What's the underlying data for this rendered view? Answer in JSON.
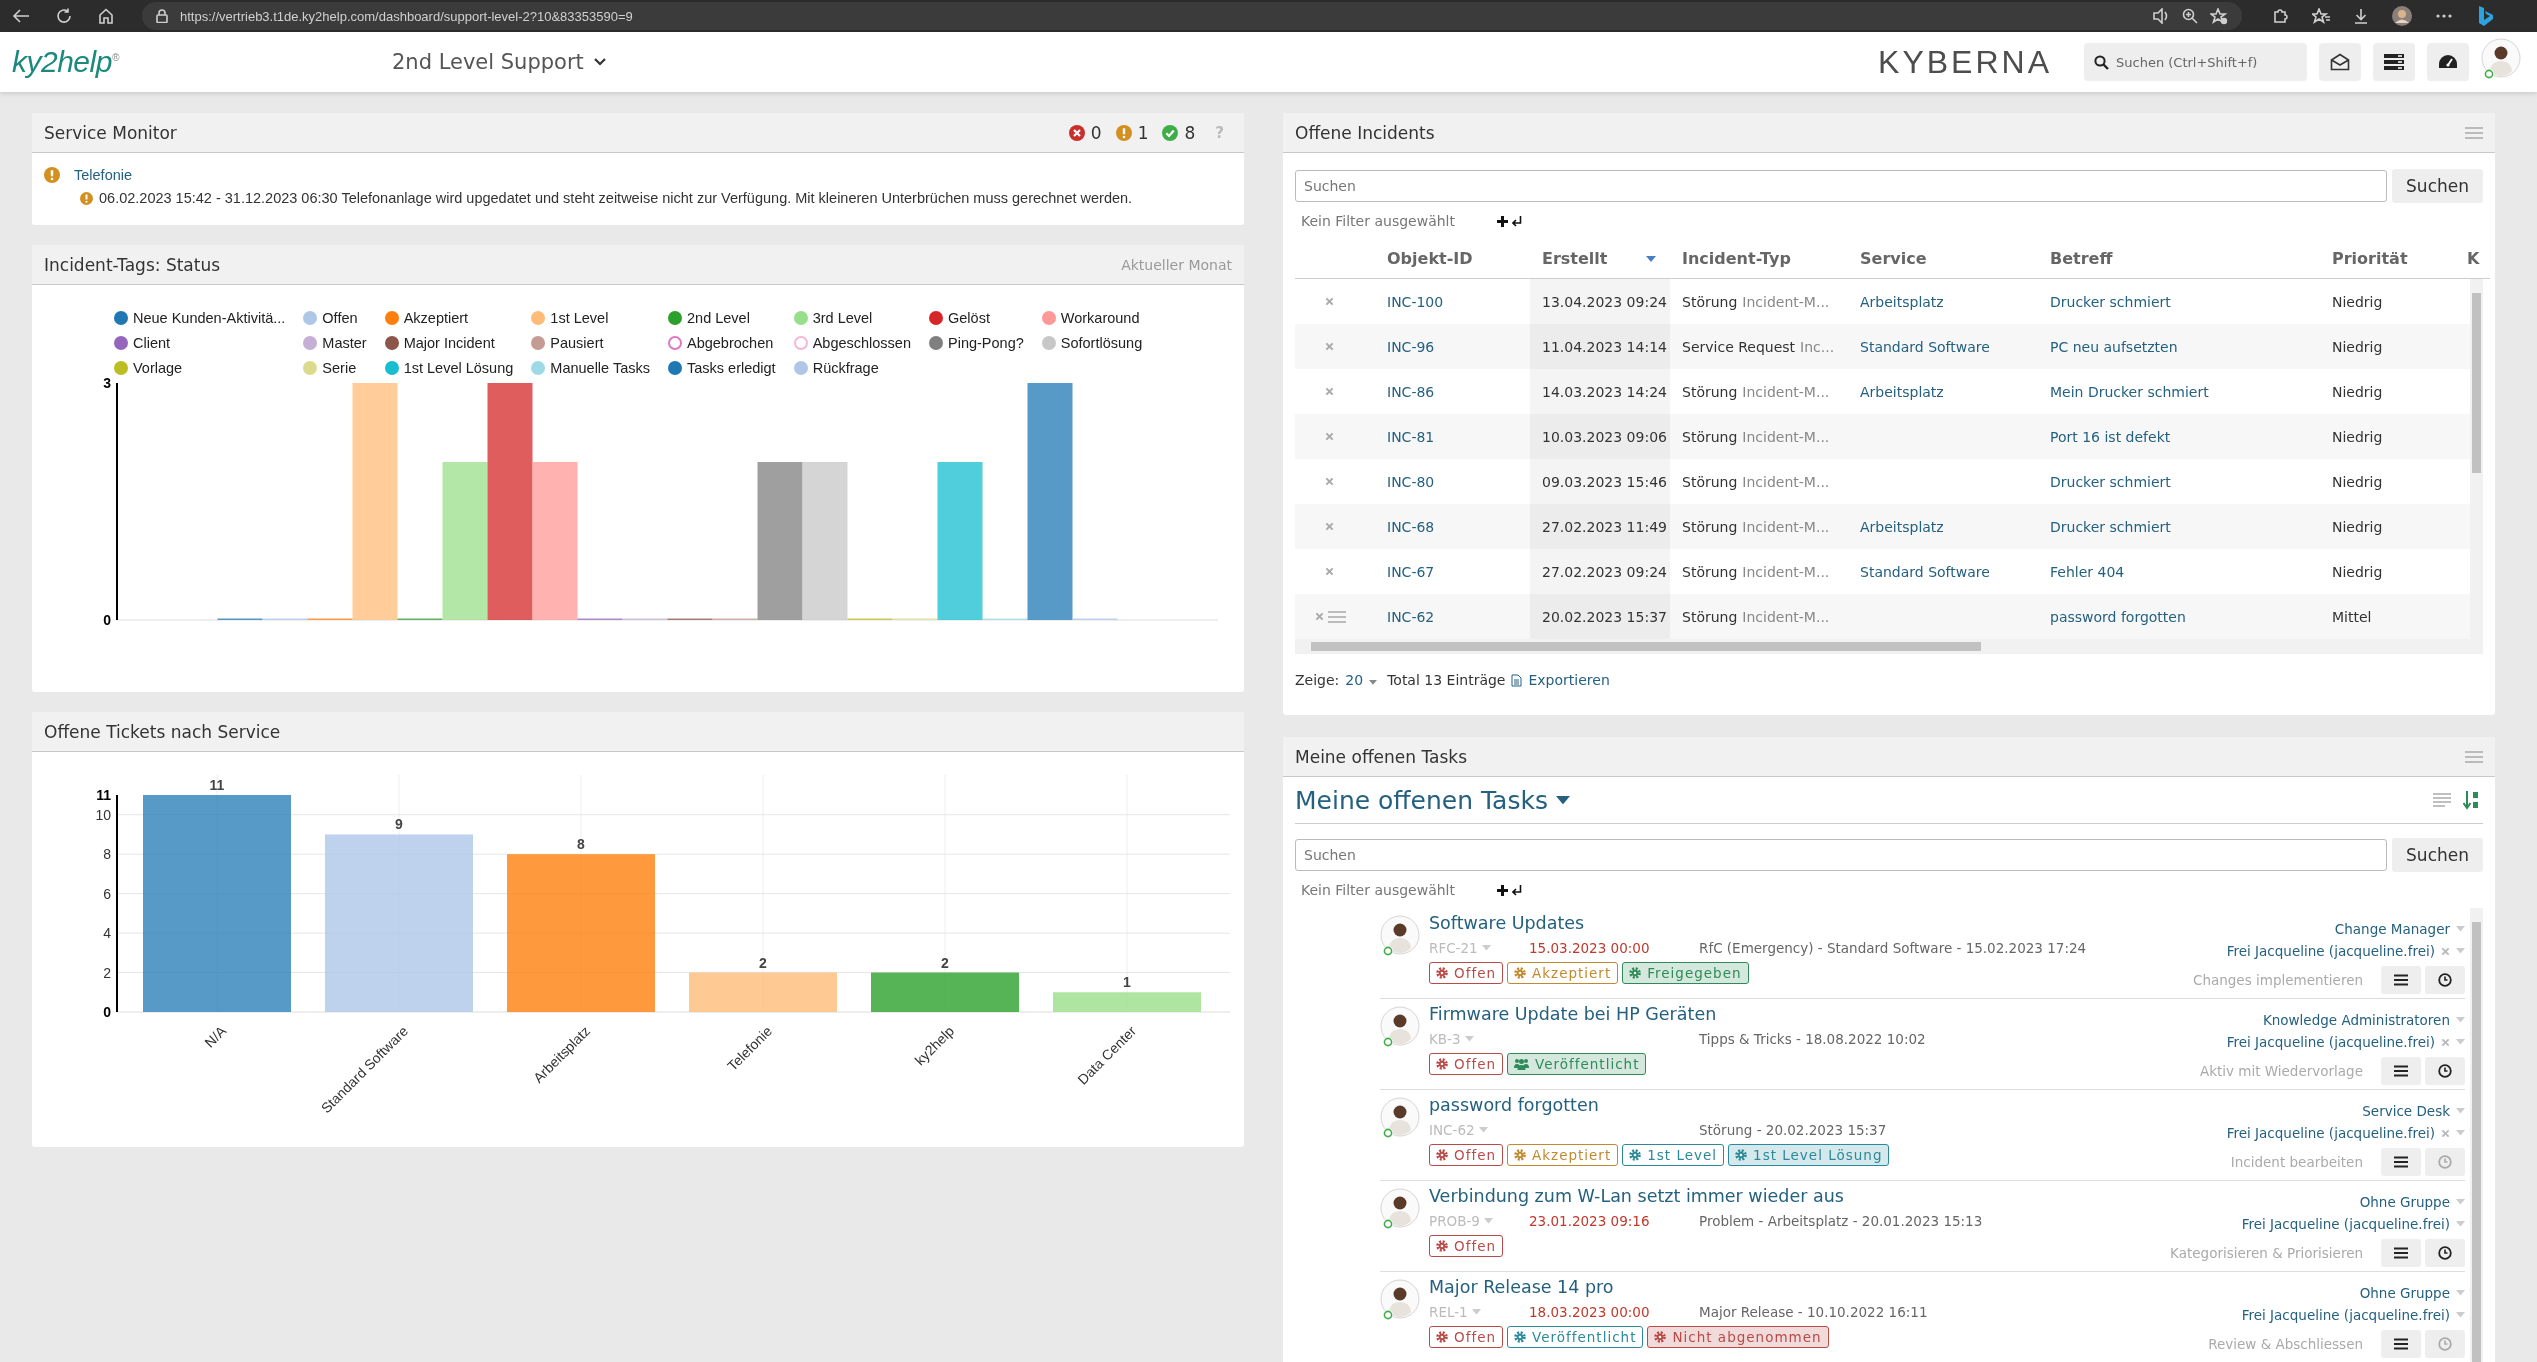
{
  "browser": {
    "url": "https://vertrieb3.t1de.ky2help.com/dashboard/support-level-2?10&83353590=9"
  },
  "header": {
    "logo": "ky2help$^{®}$",
    "dashboard": "2nd Level Support",
    "brand": "KYBERNA",
    "search": {
      "placeholder": "Suchen (Ctrl+Shift+f)"
    }
  },
  "service_monitor": {
    "title": "Service Monitor",
    "counts": [
      {
        "kind": "error",
        "value": "0"
      },
      {
        "kind": "warning",
        "value": "1"
      },
      {
        "kind": "ok",
        "value": "8"
      }
    ],
    "help": "?",
    "entries": [
      {
        "kind": "warning",
        "service": "Telefonie",
        "messages": [
          {
            "kind": "warning",
            "text": "06.02.2023 15:42 - 31.12.2023 06:30 Telefonanlage wird upgedatet und steht zeitweise nicht zur Verfügung. Mit kleineren Unterbrüchen muss gerechnet werden."
          }
        ]
      }
    ]
  },
  "incident_tags": {
    "title": "Incident-Tags: Status",
    "period": "Aktueller Monat",
    "chart_data": {
      "type": "bar",
      "legend": "top",
      "ylim": [
        0,
        3
      ],
      "yticks": [
        0,
        3
      ],
      "series": [
        {
          "name": "Neue Kunden-Aktivitä...",
          "color": "#1f77b4",
          "values": [
            0
          ]
        },
        {
          "name": "Offen",
          "color": "#aec7e8",
          "values": [
            0
          ]
        },
        {
          "name": "Akzeptiert",
          "color": "#ff7f0e",
          "values": [
            0
          ]
        },
        {
          "name": "1st Level",
          "color": "#ffbb78",
          "values": [
            3
          ]
        },
        {
          "name": "2nd Level",
          "color": "#2ca02c",
          "values": [
            0
          ]
        },
        {
          "name": "3rd Level",
          "color": "#98df8a",
          "values": [
            2
          ]
        },
        {
          "name": "Gelöst",
          "color": "#d62728",
          "values": [
            3
          ]
        },
        {
          "name": "Workaround",
          "color": "#ff9896",
          "values": [
            2
          ]
        },
        {
          "name": "Client",
          "color": "#9467bd",
          "values": [
            0
          ]
        },
        {
          "name": "Master",
          "color": "#c5b0d5",
          "values": [
            0
          ]
        },
        {
          "name": "Major Incident",
          "color": "#8c564b",
          "values": [
            0
          ]
        },
        {
          "name": "Pausiert",
          "color": "#c49c94",
          "values": [
            0
          ]
        },
        {
          "name": "Abgebrochen",
          "color": "#e377c2",
          "values": [
            null
          ]
        },
        {
          "name": "Abgeschlossen",
          "color": "#f7b6d2",
          "values": [
            null
          ]
        },
        {
          "name": "Ping-Pong?",
          "color": "#7f7f7f",
          "values": [
            2
          ]
        },
        {
          "name": "Sofortlösung",
          "color": "#c7c7c7",
          "values": [
            2
          ]
        },
        {
          "name": "Vorlage",
          "color": "#bcbd22",
          "values": [
            0
          ]
        },
        {
          "name": "Serie",
          "color": "#dbdb8d",
          "values": [
            0
          ]
        },
        {
          "name": "1st Level Lösung",
          "color": "#17becf",
          "values": [
            2
          ]
        },
        {
          "name": "Manuelle Tasks",
          "color": "#9edae5",
          "values": [
            0
          ]
        },
        {
          "name": "Tasks erledigt",
          "color": "#1f77b4",
          "values": [
            3
          ]
        },
        {
          "name": "Rückfrage",
          "color": "#aec7e8",
          "values": [
            0
          ]
        }
      ]
    }
  },
  "tickets_by_service": {
    "title": "Offene Tickets nach Service",
    "chart_data": {
      "type": "bar",
      "categories": [
        "N/A",
        "Standard Software",
        "Arbeitsplatz",
        "Telefonie",
        "ky2help",
        "Data Center"
      ],
      "values": [
        11,
        9,
        8,
        2,
        2,
        1
      ],
      "colors": [
        "#1f77b4",
        "#aec7e8",
        "#ff7f0e",
        "#ffbb78",
        "#2ca02c",
        "#98df8a"
      ],
      "ylim": [
        0,
        11
      ],
      "yticks": [
        0,
        2,
        4,
        6,
        8,
        10,
        11
      ],
      "grid": true,
      "data_labels": true
    }
  },
  "incidents": {
    "title": "Offene Incidents",
    "search": {
      "placeholder": "Suchen"
    },
    "search_button": "Suchen",
    "filter": "Kein Filter ausgewählt",
    "columns": [
      {
        "label": "Objekt-ID",
        "sorted": false
      },
      {
        "label": "Erstellt",
        "sorted": true
      },
      {
        "label": "Incident-Typ",
        "sorted": false
      },
      {
        "label": "Service",
        "sorted": false
      },
      {
        "label": "Betreff",
        "sorted": false
      },
      {
        "label": "Priorität",
        "sorted": false
      },
      {
        "label": "K",
        "sorted": false
      }
    ],
    "rows": [
      {
        "id": "INC-100",
        "created": "13.04.2023 09:24",
        "type": "Störung",
        "subtype": "Incident-M...",
        "service": "Arbeitsplatz",
        "subject": "Drucker schmiert",
        "priority": "Niedrig",
        "has_notes": false
      },
      {
        "id": "INC-96",
        "created": "11.04.2023 14:14",
        "type": "Service Request",
        "subtype": "Inc...",
        "service": "Standard Software",
        "subject": "PC neu aufsetzten",
        "priority": "Niedrig",
        "has_notes": false
      },
      {
        "id": "INC-86",
        "created": "14.03.2023 14:24",
        "type": "Störung",
        "subtype": "Incident-M...",
        "service": "Arbeitsplatz",
        "subject": "Mein Drucker schmiert",
        "priority": "Niedrig",
        "has_notes": false
      },
      {
        "id": "INC-81",
        "created": "10.03.2023 09:06",
        "type": "Störung",
        "subtype": "Incident-M...",
        "subject": "Port 16 ist defekt",
        "priority": "Niedrig",
        "has_notes": false
      },
      {
        "id": "INC-80",
        "created": "09.03.2023 15:46",
        "type": "Störung",
        "subtype": "Incident-M...",
        "subject": "Drucker schmiert",
        "priority": "Niedrig",
        "has_notes": false
      },
      {
        "id": "INC-68",
        "created": "27.02.2023 11:49",
        "type": "Störung",
        "subtype": "Incident-M...",
        "service": "Arbeitsplatz",
        "subject": "Drucker schmiert",
        "priority": "Niedrig",
        "has_notes": false
      },
      {
        "id": "INC-67",
        "created": "27.02.2023 09:24",
        "type": "Störung",
        "subtype": "Incident-M...",
        "service": "Standard Software",
        "subject": "Fehler 404",
        "priority": "Niedrig",
        "has_notes": false
      },
      {
        "id": "INC-62",
        "created": "20.02.2023 15:37",
        "type": "Störung",
        "subtype": "Incident-M...",
        "subject": "password forgotten",
        "priority": "Mittel",
        "has_notes": true
      }
    ],
    "show_label": "Zeige:",
    "page_size": "20",
    "total": "Total 13 Einträge",
    "export": "Exportieren"
  },
  "tasks": {
    "panel_title": "Meine offenen Tasks",
    "list_title": "Meine offenen Tasks",
    "search": {
      "placeholder": "Suchen"
    },
    "search_button": "Suchen",
    "filter": "Kein Filter ausgewählt",
    "items": [
      {
        "title": "Software Updates",
        "id": "RFC-21",
        "due": "15.03.2023 00:00",
        "info": "RfC (Emergency) - Standard Software - 15.02.2023 17:24",
        "tags": [
          {
            "label": "Offen",
            "kind": "gear",
            "color": "#b94a48",
            "filled": false
          },
          {
            "label": "Akzeptiert",
            "kind": "gear",
            "color": "#c28a2e",
            "filled": false
          },
          {
            "label": "Freigegeben",
            "kind": "gear",
            "color": "#2e8b57",
            "filled": true
          }
        ],
        "group": "Change Manager",
        "assignee": "Frei Jacqueline (jacqueline.frei)",
        "removable": true,
        "step": "Changes implementieren",
        "timer_disabled": false
      },
      {
        "title": "Firmware Update bei HP Geräten",
        "id": "KB-3",
        "info": "Tipps & Tricks - 18.08.2022 10:02",
        "tags": [
          {
            "label": "Offen",
            "kind": "gear",
            "color": "#b94a48",
            "filled": false
          },
          {
            "label": "Veröffentlicht",
            "kind": "people",
            "color": "#2e8b57",
            "filled": true
          }
        ],
        "group": "Knowledge Administratoren",
        "assignee": "Frei Jacqueline (jacqueline.frei)",
        "removable": true,
        "step": "Aktiv mit Wiedervorlage",
        "timer_disabled": false
      },
      {
        "title": "password forgotten",
        "id": "INC-62",
        "info": "Störung - 20.02.2023 15:37",
        "tags": [
          {
            "label": "Offen",
            "kind": "gear",
            "color": "#b94a48",
            "filled": false
          },
          {
            "label": "Akzeptiert",
            "kind": "gear",
            "color": "#c28a2e",
            "filled": false
          },
          {
            "label": "1st Level",
            "kind": "gear",
            "color": "#2b8a9a",
            "filled": false
          },
          {
            "label": "1st Level Lösung",
            "kind": "gear",
            "color": "#2b8a9a",
            "filled": true
          }
        ],
        "group": "Service Desk",
        "assignee": "Frei Jacqueline (jacqueline.frei)",
        "removable": true,
        "step": "Incident bearbeiten",
        "timer_disabled": true
      },
      {
        "title": "Verbindung zum W-Lan setzt immer wieder aus",
        "id": "PROB-9",
        "due": "23.01.2023 09:16",
        "info": "Problem - Arbeitsplatz - 20.01.2023 15:13",
        "tags": [
          {
            "label": "Offen",
            "kind": "gear",
            "color": "#b94a48",
            "filled": false
          }
        ],
        "group": "Ohne Gruppe",
        "assignee": "Frei Jacqueline (jacqueline.frei)",
        "removable": false,
        "step": "Kategorisieren & Priorisieren",
        "timer_disabled": false
      },
      {
        "title": "Major Release 14 pro",
        "id": "REL-1",
        "due": "18.03.2023 00:00",
        "info": "Major Release - 10.10.2022 16:11",
        "tags": [
          {
            "label": "Offen",
            "kind": "gear",
            "color": "#b94a48",
            "filled": false
          },
          {
            "label": "Veröffentlicht",
            "kind": "gear",
            "color": "#2b8a9a",
            "filled": false
          },
          {
            "label": "Nicht abgenommen",
            "kind": "gear",
            "color": "#b94a48",
            "filled": true
          }
        ],
        "group": "Ohne Gruppe",
        "assignee": "Frei Jacqueline (jacqueline.frei)",
        "removable": false,
        "step": "Review & Abschliessen",
        "timer_disabled": true
      }
    ]
  }
}
